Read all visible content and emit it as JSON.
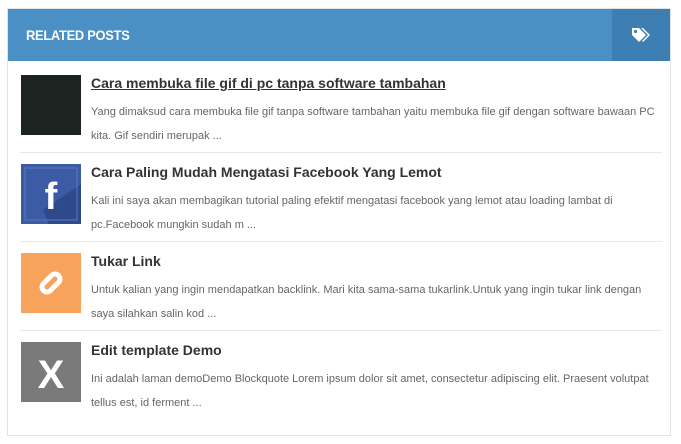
{
  "widget": {
    "title": "RELATED POSTS",
    "header_icon": "tags-icon",
    "header_color": "#4a90c4",
    "header_icon_bg": "#3d7fb3"
  },
  "posts": [
    {
      "title": "Cara membuka file gif di pc tanpa software tambahan",
      "snippet": "Yang dimaksud cara membuka file gif tanpa software tambahan yaitu membuka file gif dengan software bawaan PC kita. Gif sendiri merupak ...",
      "thumb_icon": "dark-thumbnail",
      "thumb_color": "#1c2320"
    },
    {
      "title": "Cara Paling Mudah Mengatasi Facebook Yang Lemot",
      "snippet": "Kali ini saya akan membagikan tutorial paling efektif mengatasi facebook yang lemot atau loading lambat di pc.Facebook mungkin sudah m ...",
      "thumb_icon": "facebook-icon",
      "thumb_letter": "f",
      "thumb_color": "#3b5ba5"
    },
    {
      "title": "Tukar Link",
      "snippet": "Untuk kalian yang ingin mendapatkan backlink. Mari kita sama-sama tukarlink.Untuk yang ingin tukar link dengan saya silahkan salin kod ...",
      "thumb_icon": "link-icon",
      "thumb_color": "#f7a35b"
    },
    {
      "title": "Edit template Demo",
      "snippet": "Ini adalah laman demoDemo Blockquote Lorem ipsum dolor sit amet, consectetur adipiscing elit. Praesent volutpat tellus est, id ferment ...",
      "thumb_icon": "x-icon",
      "thumb_letter": "X",
      "thumb_color": "#7a7a7a"
    }
  ]
}
